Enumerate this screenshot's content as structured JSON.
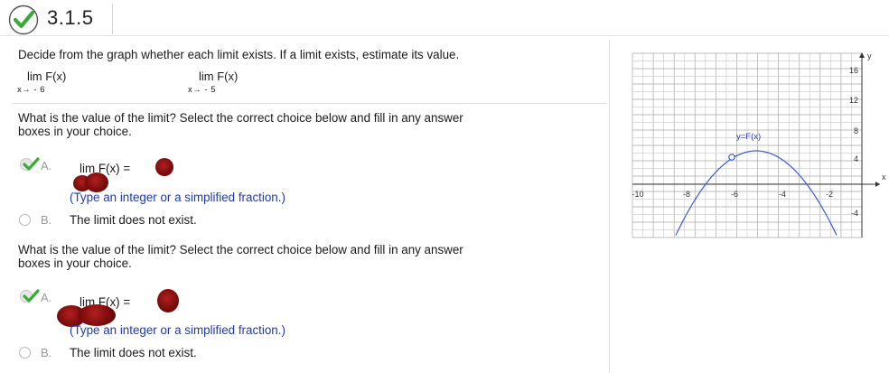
{
  "header": {
    "title": "3.1.5"
  },
  "problem": {
    "instruction": "Decide from the graph whether each limit exists. If a limit exists, estimate its value.",
    "limits": [
      {
        "top": "lim  F(x)",
        "sub": "x→ - 6"
      },
      {
        "top": "lim  F(x)",
        "sub": "x→ - 5"
      }
    ]
  },
  "questions": [
    {
      "prompt_line1": "What is the value of the limit? Select the correct choice below and fill in any answer",
      "prompt_line2": "boxes in your choice.",
      "option_a_letter": "A.",
      "option_a_expr": "lim   F(x) =",
      "option_a_hint": "(Type an integer or a simplified fraction.)",
      "option_b_letter": "B.",
      "option_b_text": "The limit does not exist."
    },
    {
      "prompt_line1": "What is the value of the limit? Select the correct choice below and fill in any answer",
      "prompt_line2": "boxes in your choice.",
      "option_a_letter": "A.",
      "option_a_expr": "lim   F(x) =",
      "option_a_hint": "(Type an integer or a simplified fraction.)",
      "option_b_letter": "B.",
      "option_b_text": "The limit does not exist."
    }
  ],
  "graph": {
    "curve_label": "y=F(x)",
    "x_axis_label": "x",
    "y_axis_label": "y",
    "x_ticks": [
      "-10",
      "-8",
      "-6",
      "-4",
      "-2"
    ],
    "y_ticks": [
      "16",
      "12",
      "8",
      "4",
      "-4"
    ],
    "colors": {
      "curve": "#3b5bd6",
      "grid": "#9a9a9a"
    }
  },
  "colors": {
    "check": "#3aaa35",
    "hint": "#1f3aa6",
    "redaction": "#8b0f0f"
  }
}
